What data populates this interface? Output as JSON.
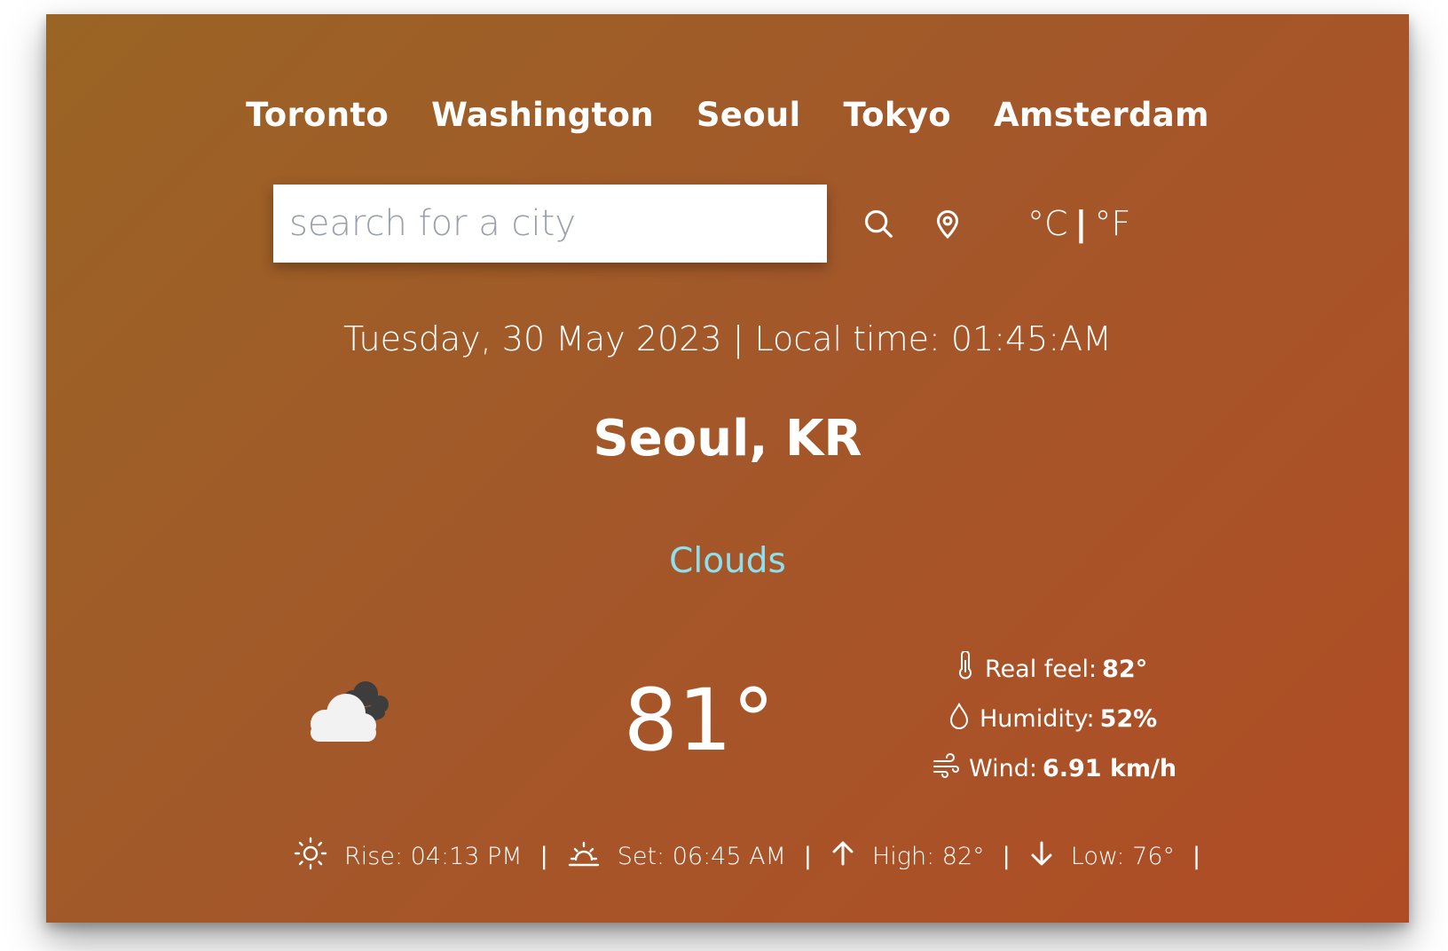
{
  "cities": [
    "Toronto",
    "Washington",
    "Seoul",
    "Tokyo",
    "Amsterdam"
  ],
  "search": {
    "placeholder": "search for a city"
  },
  "units": {
    "celsius": "°C",
    "separator": "|",
    "fahrenheit": "°F"
  },
  "datetime": "Tuesday, 30 May 2023 | Local time: 01:45:AM",
  "location": "Seoul, KR",
  "condition": "Clouds",
  "temperature": "81°",
  "details": {
    "real_feel_label": "Real feel:",
    "real_feel_value": "82°",
    "humidity_label": "Humidity:",
    "humidity_value": "52%",
    "wind_label": "Wind:",
    "wind_value": "6.91 km/h"
  },
  "bottom": {
    "rise": "Rise: 04:13 PM",
    "set": "Set: 06:45 AM",
    "high": "High: 82°",
    "low": "Low: 76°",
    "separator": "|"
  },
  "colors": {
    "condition": "#8ee0ee",
    "gradient_start": "#9a6424",
    "gradient_end": "#b04c25"
  },
  "icons": {
    "weather": "cloud-icon",
    "search": "search-icon",
    "location": "location-pin-icon",
    "real_feel": "thermometer-icon",
    "humidity": "droplet-icon",
    "wind": "wind-icon",
    "rise": "sunrise-icon",
    "set": "sunset-icon",
    "high": "arrow-up-icon",
    "low": "arrow-down-icon"
  }
}
